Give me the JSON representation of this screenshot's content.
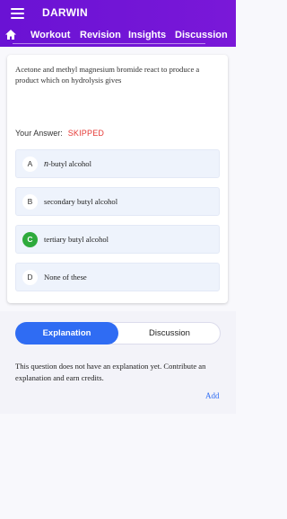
{
  "header": {
    "title": "DARWIN",
    "tabs": [
      "Workout",
      "Revision",
      "Insights",
      "Discussion"
    ]
  },
  "question": {
    "text": "Acetone and methyl magnesium bromide react to produce a product which on hydrolysis gives",
    "answer_label": "Your Answer:",
    "answer_status": "SKIPPED",
    "options": [
      {
        "letter": "A",
        "prefix": "n",
        "text": "-butyl alcohol",
        "correct": false
      },
      {
        "letter": "B",
        "prefix": "",
        "text": "secondary butyl alcohol",
        "correct": false
      },
      {
        "letter": "C",
        "prefix": "",
        "text": "tertiary butyl alcohol",
        "correct": true
      },
      {
        "letter": "D",
        "prefix": "",
        "text": "None of these",
        "correct": false
      }
    ]
  },
  "toggle": {
    "explanation": "Explanation",
    "discussion": "Discussion"
  },
  "explanation": {
    "text": "This question does not have an explanation yet. Contribute an explanation and earn credits.",
    "add_label": "Add"
  },
  "colors": {
    "header": "#6a12d4",
    "accent": "#2f6cf3",
    "correct": "#2eaa3c",
    "skipped": "#e53935"
  },
  "icons": [
    "menu-icon",
    "home-icon"
  ]
}
